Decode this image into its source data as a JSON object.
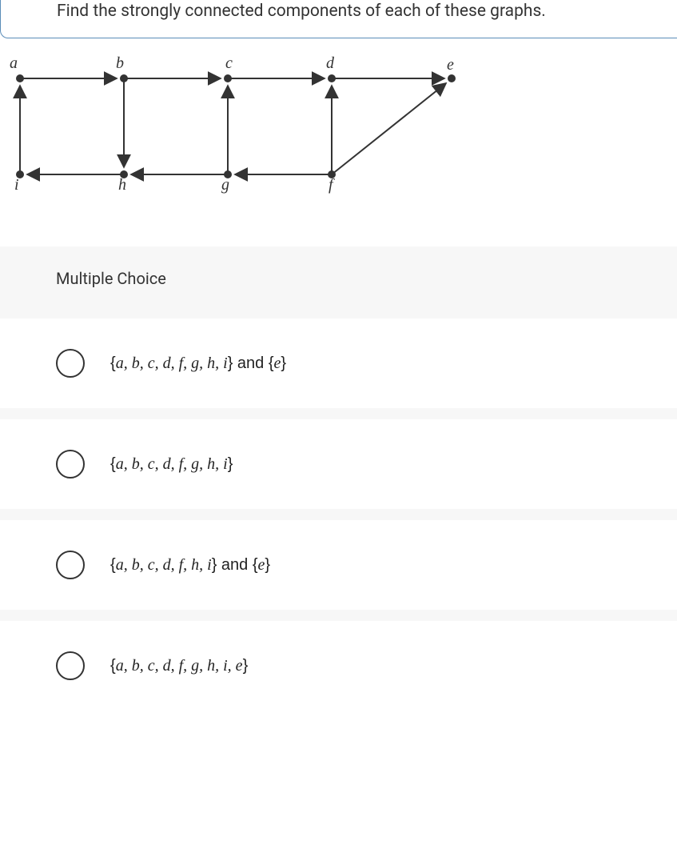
{
  "question": {
    "prompt": "Find the strongly connected components of each of these graphs."
  },
  "mc_heading": "Multiple Choice",
  "graph": {
    "vertices": {
      "a": "a",
      "b": "b",
      "c": "c",
      "d": "d",
      "e": "e",
      "f": "f",
      "g": "g",
      "h": "h",
      "i": "i"
    }
  },
  "chart_data": {
    "type": "graph",
    "directed": true,
    "vertices": [
      "a",
      "b",
      "c",
      "d",
      "e",
      "i",
      "h",
      "g",
      "f"
    ],
    "positions": {
      "a": [
        0,
        0
      ],
      "b": [
        1,
        0
      ],
      "c": [
        2,
        0
      ],
      "d": [
        3,
        0
      ],
      "e": [
        4,
        0
      ],
      "i": [
        0,
        1
      ],
      "h": [
        1,
        1
      ],
      "g": [
        2,
        1
      ],
      "f": [
        3,
        1
      ]
    },
    "edges": [
      [
        "a",
        "b"
      ],
      [
        "b",
        "c"
      ],
      [
        "c",
        "d"
      ],
      [
        "d",
        "e"
      ],
      [
        "b",
        "h"
      ],
      [
        "g",
        "c"
      ],
      [
        "f",
        "d"
      ],
      [
        "f",
        "e"
      ],
      [
        "h",
        "i"
      ],
      [
        "i",
        "a"
      ],
      [
        "g",
        "h"
      ],
      [
        "f",
        "g"
      ]
    ]
  },
  "options": [
    {
      "label_html": "{a, b, c, d, f, g, h, i} and {e}"
    },
    {
      "label_html": "{a, b, c, d, f, g, h, i}"
    },
    {
      "label_html": "{a, b, c, d, f, h, i} and {e}"
    },
    {
      "label_html": "{a, b, c, d, f, g, h, i, e}"
    }
  ]
}
